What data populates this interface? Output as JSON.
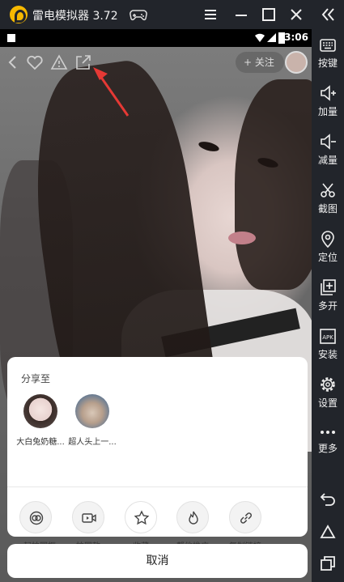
{
  "titlebar": {
    "app_title": "雷电模拟器 3.72",
    "icons": [
      "gamepad-icon",
      "menu-icon",
      "minimize-icon",
      "maximize-icon",
      "close-icon"
    ]
  },
  "rightbar": {
    "items": [
      {
        "label": "按键",
        "icon": "keyboard-icon"
      },
      {
        "label": "加量",
        "icon": "volume-up-icon"
      },
      {
        "label": "减量",
        "icon": "volume-down-icon"
      },
      {
        "label": "截图",
        "icon": "scissors-icon"
      },
      {
        "label": "定位",
        "icon": "location-icon"
      },
      {
        "label": "多开",
        "icon": "multi-open-icon"
      },
      {
        "label": "安装",
        "icon": "apk-install-icon"
      },
      {
        "label": "设置",
        "icon": "gear-icon"
      },
      {
        "label": "更多",
        "icon": "more-icon"
      }
    ]
  },
  "statusbar": {
    "time": "3:06"
  },
  "video": {
    "follow_label": "+ 关注"
  },
  "share_sheet": {
    "heading": "分享至",
    "friends": [
      {
        "name": "大白兔奶糖..."
      },
      {
        "name": "超人头上一..."
      }
    ],
    "actions": [
      {
        "label": "一起拍同框",
        "icon": "duet-icon"
      },
      {
        "label": "拍同款",
        "icon": "video-camera-icon"
      },
      {
        "label": "收藏",
        "icon": "star-icon"
      },
      {
        "label": "帮他推广",
        "icon": "flame-icon"
      },
      {
        "label": "复制链接",
        "icon": "link-icon"
      }
    ],
    "cancel_label": "取消"
  },
  "colors": {
    "emulator_bg": "#22252b",
    "accent_logo": "#f6b800",
    "annotation_arrow": "#e53935"
  }
}
